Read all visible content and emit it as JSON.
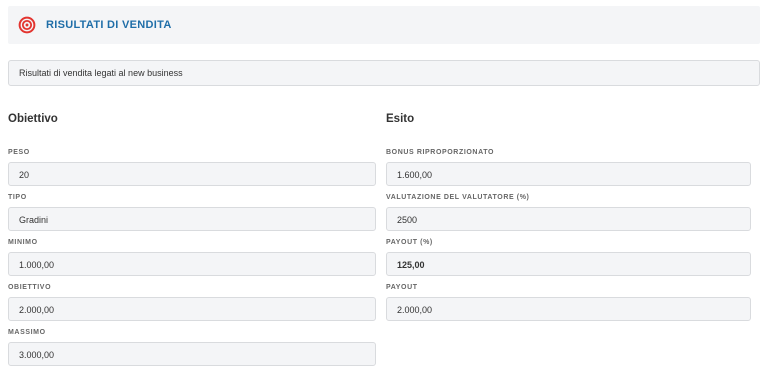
{
  "header": {
    "icon": "target-icon",
    "title": "RISULTATI DI VENDITA",
    "accent_color": "#1f6ea8",
    "icon_color": "#e3342f"
  },
  "description": "Risultati di vendita legati al new business",
  "left": {
    "title": "Obiettivo",
    "fields": [
      {
        "label": "PESO",
        "value": "20"
      },
      {
        "label": "TIPO",
        "value": "Gradini"
      },
      {
        "label": "MINIMO",
        "value": "1.000,00"
      },
      {
        "label": "OBIETTIVO",
        "value": "2.000,00"
      },
      {
        "label": "MASSIMO",
        "value": "3.000,00"
      }
    ]
  },
  "right": {
    "title": "Esito",
    "fields": [
      {
        "label": "BONUS RIPROPORZIONATO",
        "value": "1.600,00"
      },
      {
        "label": "VALUTAZIONE DEL VALUTATORE (%)",
        "value": "2500"
      },
      {
        "label": "PAYOUT (%)",
        "value": "125,00"
      },
      {
        "label": "PAYOUT",
        "value": "2.000,00"
      }
    ]
  }
}
